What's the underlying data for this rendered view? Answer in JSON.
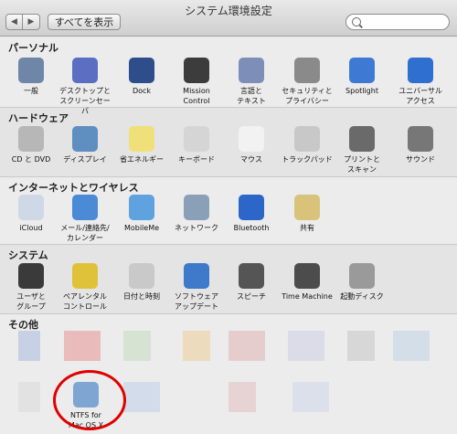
{
  "window": {
    "title": "システム環境設定"
  },
  "toolbar": {
    "back": "◀",
    "forward": "▶",
    "show_all": "すべてを表示",
    "search_placeholder": ""
  },
  "sections": [
    {
      "title": "パーソナル",
      "items": [
        {
          "label": "一般",
          "color": "#6e86a8"
        },
        {
          "label": "デスクトップと\nスクリーンセーバ",
          "color": "#5b6ec2"
        },
        {
          "label": "Dock",
          "color": "#2d4e8a"
        },
        {
          "label": "Mission\nControl",
          "color": "#3c3c3c"
        },
        {
          "label": "言語と\nテキスト",
          "color": "#7d8fb8"
        },
        {
          "label": "セキュリティと\nプライバシー",
          "color": "#8a8a8a"
        },
        {
          "label": "Spotlight",
          "color": "#3e7ad4"
        },
        {
          "label": "ユニバーサル\nアクセス",
          "color": "#2f6fd0"
        }
      ]
    },
    {
      "title": "ハードウェア",
      "items": [
        {
          "label": "CD と DVD",
          "color": "#b7b7b7"
        },
        {
          "label": "ディスプレイ",
          "color": "#5f8ec0"
        },
        {
          "label": "省エネルギー",
          "color": "#f0e07a"
        },
        {
          "label": "キーボード",
          "color": "#d5d5d5"
        },
        {
          "label": "マウス",
          "color": "#f2f2f2"
        },
        {
          "label": "トラックパッド",
          "color": "#c8c8c8"
        },
        {
          "label": "プリントと\nスキャン",
          "color": "#6a6a6a"
        },
        {
          "label": "サウンド",
          "color": "#777777"
        }
      ]
    },
    {
      "title": "インターネットとワイヤレス",
      "items": [
        {
          "label": "iCloud",
          "color": "#cfd8e6"
        },
        {
          "label": "メール/連絡先/\nカレンダー",
          "color": "#4a8ad6"
        },
        {
          "label": "MobileMe",
          "color": "#5fa2e0"
        },
        {
          "label": "ネットワーク",
          "color": "#8aa0b8"
        },
        {
          "label": "Bluetooth",
          "color": "#2c66c8"
        },
        {
          "label": "共有",
          "color": "#d9c27a"
        }
      ]
    },
    {
      "title": "システム",
      "items": [
        {
          "label": "ユーザと\nグループ",
          "color": "#3a3a3a"
        },
        {
          "label": "ペアレンタル\nコントロール",
          "color": "#e0c23a"
        },
        {
          "label": "日付と時刻",
          "color": "#c9c9c9"
        },
        {
          "label": "ソフトウェア\nアップデート",
          "color": "#3f79c9"
        },
        {
          "label": "スピーチ",
          "color": "#555555"
        },
        {
          "label": "Time Machine",
          "color": "#4c4c4c"
        },
        {
          "label": "起動ディスク",
          "color": "#9a9a9a"
        }
      ]
    },
    {
      "title": "その他",
      "items": [
        {
          "label": "NTFS for\nMac OS X",
          "color": "#7fa6d2"
        }
      ]
    }
  ],
  "blurred": [
    "#b8c6e0",
    "#e9a6a6",
    "#cfe0c8",
    "#ecd4a8",
    "#e4c0c0",
    "#d6d6e8",
    "#cfcfcf",
    "#c9d8e8",
    "#dedede",
    "#c8d6ea",
    "#e6c9c9",
    "#d4dcea"
  ]
}
